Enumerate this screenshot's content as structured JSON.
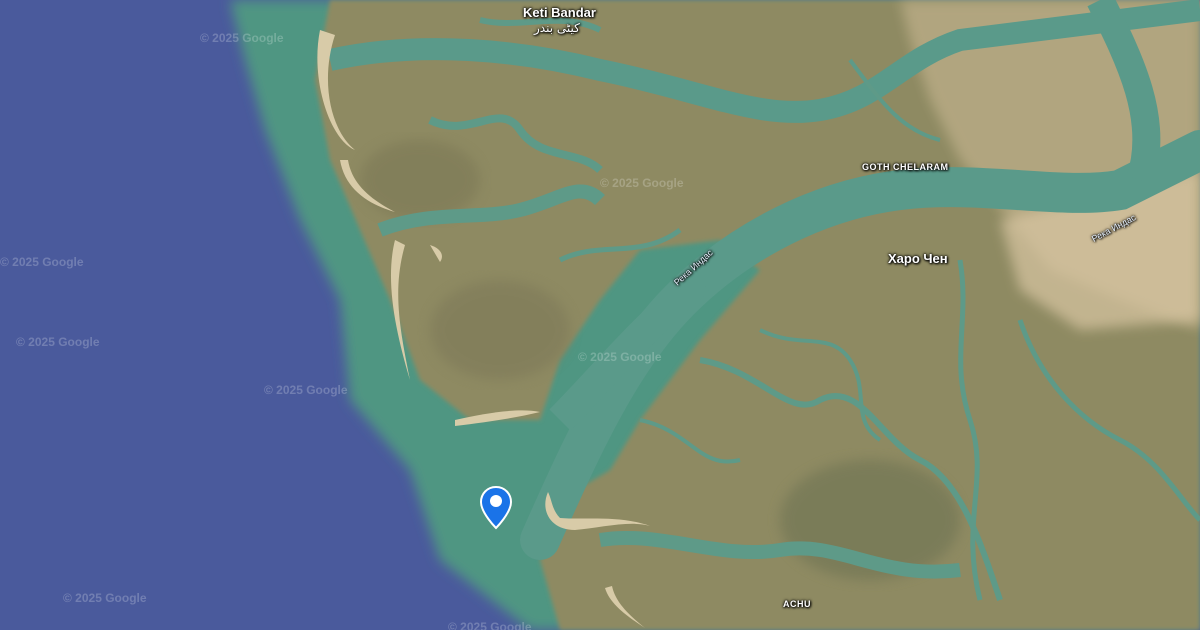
{
  "map": {
    "type": "satellite",
    "colors": {
      "ocean": "#4a5a9c",
      "shallow_water": "#4f9682",
      "land": "#8e8a62",
      "sand": "#d8cba8",
      "river": "#5a9a8a",
      "pin": "#1a73e8"
    }
  },
  "places": {
    "keti_bandar": "Keti Bandar",
    "keti_bandar_local": "کیٹی بندر",
    "goth_chelaram": "GOTH CHELARAM",
    "kharo_chan": "Харо Чен",
    "achu": "ACHU"
  },
  "rivers": {
    "indus_1": "Река Индас",
    "indus_2": "Река Индас"
  },
  "watermark": "© 2025 Google",
  "pin": {
    "icon": "location-pin-icon"
  }
}
